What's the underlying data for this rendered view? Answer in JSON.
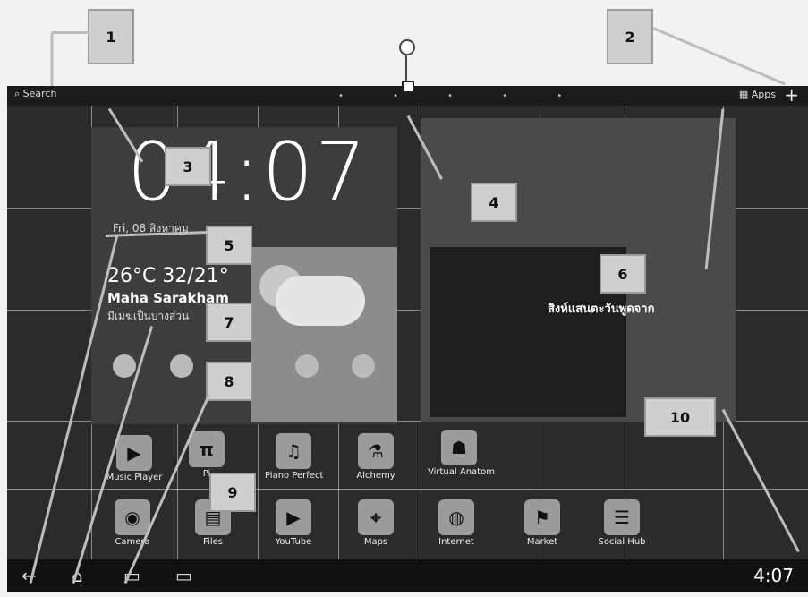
{
  "callouts": [
    "1",
    "2",
    "3",
    "4",
    "5",
    "6",
    "7",
    "8",
    "9",
    "10"
  ],
  "topbar": {
    "search_label": "Search",
    "apps_label": "Apps",
    "add_label": "+"
  },
  "clock": {
    "time": "04:07"
  },
  "weather": {
    "date": "Fri, 08 สิงหาคม",
    "temp": "26°C 32/21°",
    "city": "Maha Sarakham",
    "condition": "มีเมฆเป็นบางส่วน"
  },
  "photo": {
    "caption": "สิงห์แสนตะวันพูดจาก"
  },
  "apps_row1": [
    {
      "label": "Music Player",
      "icon": "play-icon"
    },
    {
      "label": "Pi",
      "icon": "pi-icon"
    },
    {
      "label": "Piano Perfect",
      "icon": "piano-icon"
    },
    {
      "label": "Alchemy",
      "icon": "flask-icon"
    },
    {
      "label": "Virtual Anatom",
      "icon": "anatomy-icon"
    }
  ],
  "apps_row2": [
    {
      "label": "Camera",
      "icon": "camera-icon"
    },
    {
      "label": "Files",
      "icon": "files-icon"
    },
    {
      "label": "YouTube",
      "icon": "youtube-icon"
    },
    {
      "label": "Maps",
      "icon": "map-icon"
    },
    {
      "label": "Internet",
      "icon": "globe-icon"
    },
    {
      "label": "Market",
      "icon": "market-icon"
    },
    {
      "label": "Social Hub",
      "icon": "social-icon"
    }
  ],
  "status": {
    "time": "4:07"
  },
  "nav": {
    "back": "←",
    "home": "⌂",
    "recent": "▭",
    "screenshot": "▭"
  }
}
